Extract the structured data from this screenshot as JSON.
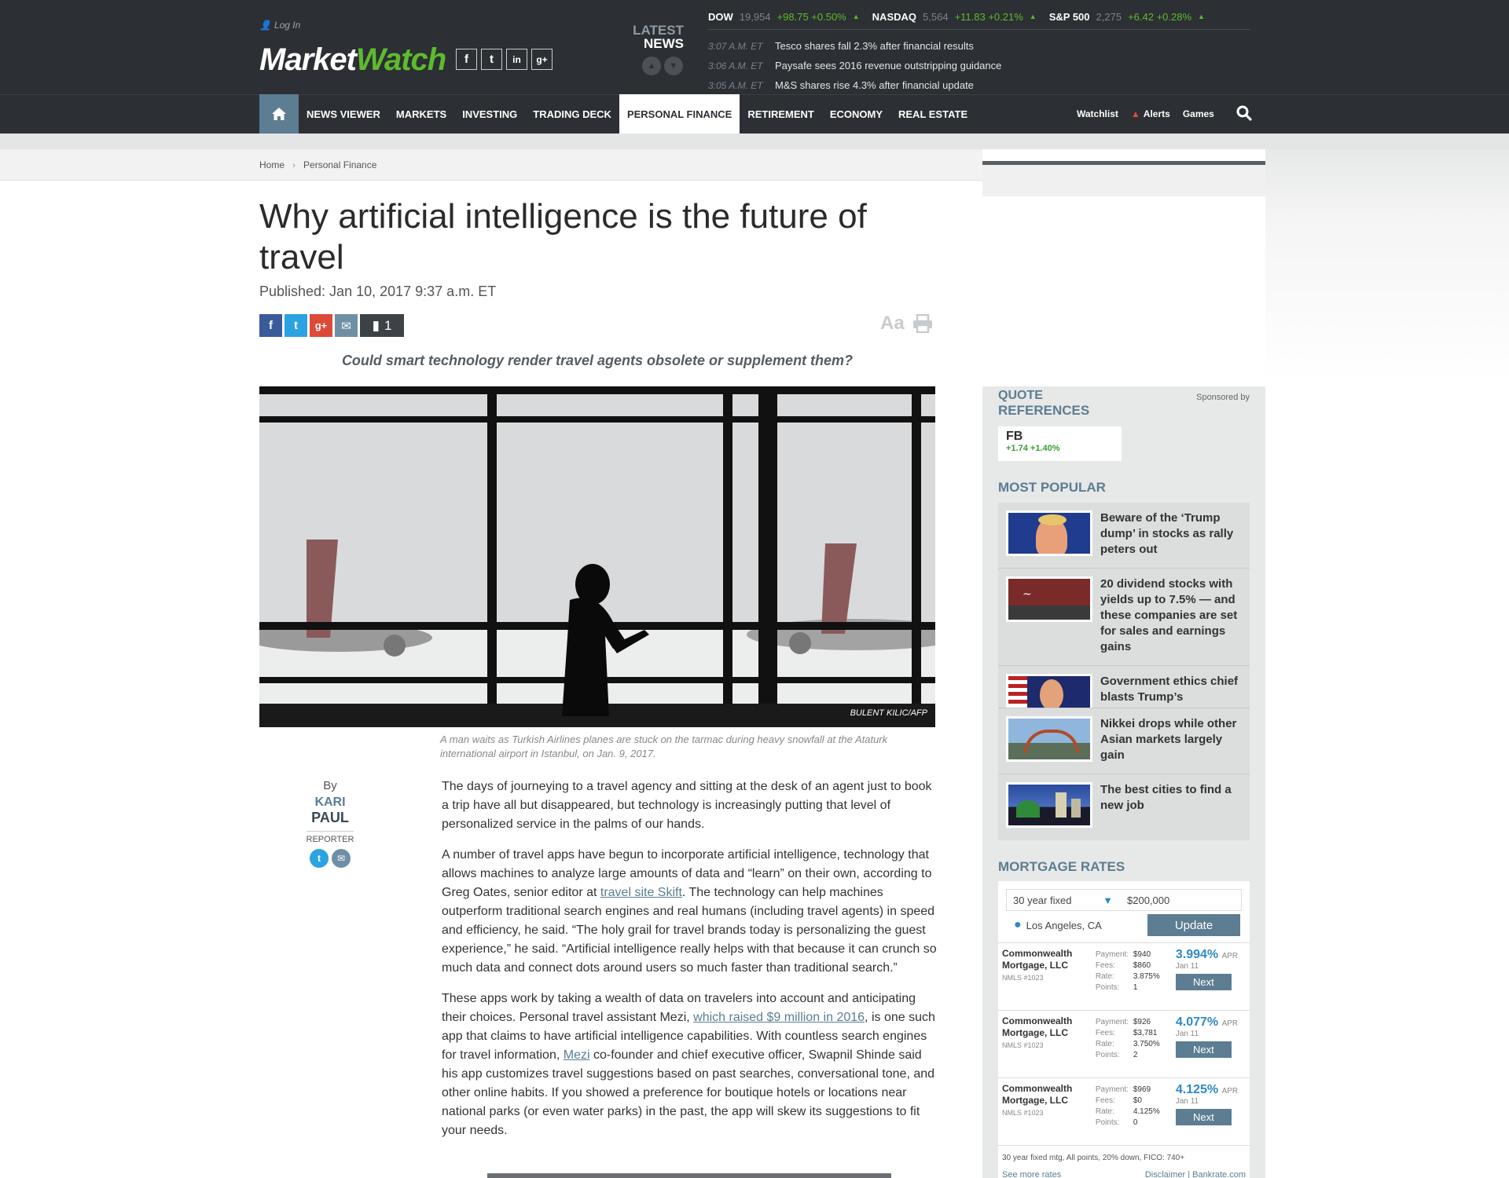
{
  "header": {
    "login_label": "Log In",
    "logo_market": "Market",
    "logo_watch": "Watch",
    "social": [
      "f",
      "t",
      "in",
      "g+"
    ],
    "latest_line1": "LATEST",
    "latest_line2": "NEWS",
    "tickers": [
      {
        "name": "DOW",
        "value": "19,954",
        "change": "+98.75 +0.50%"
      },
      {
        "name": "NASDAQ",
        "value": "5,564",
        "change": "+11.83 +0.21%"
      },
      {
        "name": "S&P 500",
        "value": "2,275",
        "change": "+6.42 +0.28%"
      }
    ],
    "news": [
      {
        "time": "3:07 A.M. ET",
        "headline": "Tesco shares fall 2.3% after financial results"
      },
      {
        "time": "3:06 A.M. ET",
        "headline": "Paysafe sees 2016 revenue outstripping guidance"
      },
      {
        "time": "3:05 A.M. ET",
        "headline": "M&S shares rise 4.3% after financial update"
      }
    ]
  },
  "nav": {
    "items": [
      "News Viewer",
      "Markets",
      "Investing",
      "Trading Deck",
      "Personal Finance",
      "Retirement",
      "Economy",
      "Real Estate"
    ],
    "active_index": 4,
    "watchlist": "Watchlist",
    "alerts": "Alerts",
    "games": "Games"
  },
  "breadcrumb": {
    "home": "Home",
    "section": "Personal Finance"
  },
  "article": {
    "title": "Why artificial intelligence is the future of travel",
    "published": "Published: Jan 10, 2017 9:37 a.m. ET",
    "comment_count": "1",
    "text_tool": "Aa",
    "dek": "Could smart technology render travel agents obsolete or supplement them?",
    "photo_credit": "BULENT KILIC/AFP",
    "caption": "A man waits as Turkish Airlines planes are stuck on the tarmac during heavy snowfall at the Ataturk international airport in Istanbul, on Jan. 9, 2017.",
    "byline_by": "By",
    "author_first": "KARI",
    "author_last": "PAUL",
    "author_role": "REPORTER",
    "p1": "The days of journeying to a travel agency and sitting at the desk of an agent just to book a trip have all but disappeared, but technology is increasingly putting that level of personalized service in the palms of our hands.",
    "p2_a": "A number of travel apps have begun to incorporate artificial intelligence, technology that allows machines to analyze large amounts of data and “learn” on their own, according to Greg Oates, senior editor at ",
    "p2_link": "travel site Skift",
    "p2_b": ". The technology can help machines outperform traditional search engines and real humans (including travel agents) in speed and efficiency, he said. “The holy grail for travel brands today is personalizing the guest experience,” he said. “Artificial intelligence really helps with that because it can crunch so much data and connect dots around users so much faster than traditional search.”",
    "p3_a": "These apps work by taking a wealth of data on travelers into account and anticipating their choices. Personal travel assistant Mezi, ",
    "p3_link1": "which raised $9 million in 2016",
    "p3_b": ", is one such app that claims to have artificial intelligence capabilities. With countless search engines for travel information, ",
    "p3_link2": "Mezi",
    "p3_c": " co-founder and chief executive officer, Swapnil Shinde said his app customizes travel suggestions based on past searches, conversational tone, and other online habits. If you showed a preference for boutique hotels or locations near national parks (or even water parks) in the past, the app will skew its suggestions to fit your needs."
  },
  "sidebar": {
    "quote_title_1": "QUOTE",
    "quote_title_2": "REFERENCES",
    "sponsored": "Sponsored by",
    "quote_symbol": "FB",
    "quote_change": "+1.74 +1.40%",
    "popular_title": "MOST POPULAR",
    "popular": [
      "Beware of the ‘Trump dump’ in stocks as rally peters out",
      "20 dividend stocks with yields up to 7.5% — and these companies are set for sales and earnings gains",
      "Government ethics chief blasts Trump’s",
      "Nikkei drops while other Asian markets largely gain",
      "The best cities to find a new job"
    ],
    "mortgage_title": "MORTGAGE RATES",
    "mortgage_type": "30 year fixed",
    "mortgage_amount": "$200,000",
    "mortgage_location": "Los Angeles, CA",
    "update_label": "Update",
    "lenders": [
      {
        "name": "Commonwealth Mortgage, LLC",
        "nmls": "NMLS #1023",
        "payment": "$940",
        "fees": "$860",
        "rate": "3.875%",
        "points": "1",
        "apr": "3.994%",
        "date": "Jan 11"
      },
      {
        "name": "Commonwealth Mortgage, LLC",
        "nmls": "NMLS #1023",
        "payment": "$926",
        "fees": "$3,781",
        "rate": "3.750%",
        "points": "2",
        "apr": "4.077%",
        "date": "Jan 11"
      },
      {
        "name": "Commonwealth Mortgage, LLC",
        "nmls": "NMLS #1023",
        "payment": "$969",
        "fees": "$0",
        "rate": "4.125%",
        "points": "0",
        "apr": "4.125%",
        "date": "Jan 11"
      }
    ],
    "labels": {
      "payment": "Payment:",
      "fees": "Fees:",
      "rate": "Rate:",
      "points": "Points:",
      "apr": "APR",
      "next": "Next"
    },
    "mortgage_footer": "30 year fixed mtg,  All points,  20% down,  FICO: 740+",
    "see_more": "See more rates",
    "disclaimer": "Disclaimer | Bankrate.com"
  },
  "colors": {
    "brand_green": "#5dbb2e",
    "nav_bg": "#2c2f33",
    "accent_blue": "#5c7d92",
    "apr_blue": "#2d89c8"
  }
}
